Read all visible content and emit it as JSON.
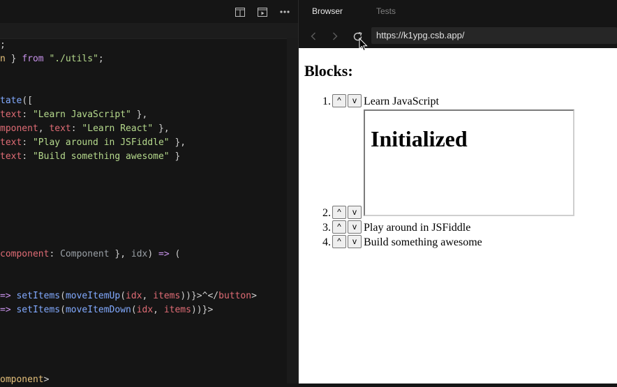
{
  "editor": {
    "lines": [
      [
        {
          "t": ";",
          "c": "w"
        }
      ],
      [
        {
          "t": "n",
          "c": "c"
        },
        {
          "t": " } ",
          "c": "w"
        },
        {
          "t": "from",
          "c": "k"
        },
        {
          "t": " ",
          "c": "w"
        },
        {
          "t": "\"./utils\"",
          "c": "s"
        },
        {
          "t": ";",
          "c": "w"
        }
      ],
      [],
      [],
      [
        {
          "t": "tate",
          "c": "f"
        },
        {
          "t": "([",
          "c": "w"
        }
      ],
      [
        {
          "t": "text",
          "c": "p"
        },
        {
          "t": ": ",
          "c": "w"
        },
        {
          "t": "\"Learn JavaScript\"",
          "c": "s"
        },
        {
          "t": " },",
          "c": "w"
        }
      ],
      [
        {
          "t": "mponent",
          "c": "p"
        },
        {
          "t": ", ",
          "c": "w"
        },
        {
          "t": "text",
          "c": "p"
        },
        {
          "t": ": ",
          "c": "w"
        },
        {
          "t": "\"Learn React\"",
          "c": "s"
        },
        {
          "t": " },",
          "c": "w"
        }
      ],
      [
        {
          "t": "text",
          "c": "p"
        },
        {
          "t": ": ",
          "c": "w"
        },
        {
          "t": "\"Play around in JSFiddle\"",
          "c": "s"
        },
        {
          "t": " },",
          "c": "w"
        }
      ],
      [
        {
          "t": "text",
          "c": "p"
        },
        {
          "t": ": ",
          "c": "w"
        },
        {
          "t": "\"Build something awesome\"",
          "c": "s"
        },
        {
          "t": " }",
          "c": "w"
        }
      ],
      [],
      [],
      [],
      [],
      [],
      [],
      [
        {
          "t": "component",
          "c": "p"
        },
        {
          "t": ": ",
          "c": "w"
        },
        {
          "t": "Component",
          "c": "g"
        },
        {
          "t": " }, ",
          "c": "w"
        },
        {
          "t": "idx",
          "c": "g"
        },
        {
          "t": ") ",
          "c": "w"
        },
        {
          "t": "=>",
          "c": "o"
        },
        {
          "t": " (",
          "c": "w"
        }
      ],
      [],
      [],
      [
        {
          "t": "=>",
          "c": "o"
        },
        {
          "t": " ",
          "c": "w"
        },
        {
          "t": "setItems",
          "c": "f"
        },
        {
          "t": "(",
          "c": "w"
        },
        {
          "t": "moveItemUp",
          "c": "f"
        },
        {
          "t": "(",
          "c": "w"
        },
        {
          "t": "idx",
          "c": "p"
        },
        {
          "t": ", ",
          "c": "w"
        },
        {
          "t": "items",
          "c": "p"
        },
        {
          "t": "))}>^</",
          "c": "w"
        },
        {
          "t": "button",
          "c": "p"
        },
        {
          "t": ">",
          "c": "w"
        }
      ],
      [
        {
          "t": "=>",
          "c": "o"
        },
        {
          "t": " ",
          "c": "w"
        },
        {
          "t": "setItems",
          "c": "f"
        },
        {
          "t": "(",
          "c": "w"
        },
        {
          "t": "moveItemDown",
          "c": "f"
        },
        {
          "t": "(",
          "c": "w"
        },
        {
          "t": "idx",
          "c": "p"
        },
        {
          "t": ", ",
          "c": "w"
        },
        {
          "t": "items",
          "c": "p"
        },
        {
          "t": "))}>",
          "c": "w"
        }
      ],
      [],
      [],
      [],
      [],
      [
        {
          "t": "omponent",
          "c": "c"
        },
        {
          "t": ">",
          "c": "w"
        }
      ]
    ],
    "toolbar_icons": [
      "split-view-icon",
      "preview-window-icon",
      "more-icon"
    ]
  },
  "preview": {
    "tabs": [
      {
        "label": "Browser",
        "active": true
      },
      {
        "label": "Tests",
        "active": false
      }
    ],
    "url": "https://k1ypg.csb.app/",
    "heading": "Blocks:",
    "items": [
      {
        "num": "1.",
        "up": "^",
        "down": "v",
        "text": "Learn JavaScript"
      },
      {
        "num": "2.",
        "up": "^",
        "down": "v",
        "text": ""
      },
      {
        "num": "3.",
        "up": "^",
        "down": "v",
        "text": "Play around in JSFiddle"
      },
      {
        "num": "4.",
        "up": "^",
        "down": "v",
        "text": "Build something awesome"
      }
    ],
    "iframe_heading": "Initialized"
  },
  "colors": {
    "tab_active": "#e8e8e8",
    "tab_inactive": "#808080",
    "panel_bg": "#151515",
    "page_bg": "#ffffff"
  }
}
